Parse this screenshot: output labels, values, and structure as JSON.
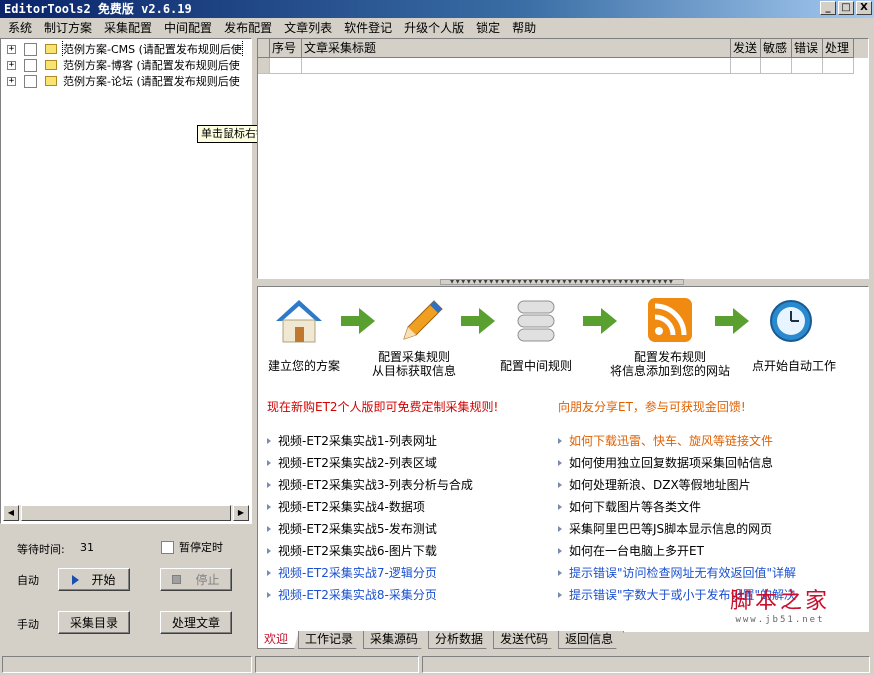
{
  "window": {
    "title": "EditorTools2 免费版 v2.6.19",
    "min": "_",
    "max": "□",
    "close": "X"
  },
  "menu": [
    "系统",
    "制订方案",
    "采集配置",
    "中间配置",
    "发布配置",
    "文章列表",
    "软件登记",
    "升级个人版",
    "锁定",
    "帮助"
  ],
  "tree": [
    {
      "label": "范例方案-CMS (请配置发布规则后使"
    },
    {
      "label": "范例方案-博客 (请配置发布规则后使"
    },
    {
      "label": "范例方案-论坛 (请配置发布规则后使"
    }
  ],
  "tooltip": "单击鼠标右键显示操作菜单",
  "controls": {
    "wait_label": "等待时间:",
    "wait_value": "31",
    "pause_label": "暂停定时",
    "auto_label": "自动",
    "start": "开始",
    "stop": "停止",
    "manual_label": "手动",
    "collect_dir": "采集目录",
    "process": "处理文章"
  },
  "grid": {
    "columns": [
      "序号",
      "文章采集标题",
      "发送",
      "敏感",
      "错误",
      "处理"
    ]
  },
  "steps": [
    {
      "line1": "建立您的方案",
      "line2": "",
      "icon": "home-icon"
    },
    {
      "line1": "配置采集规则",
      "line2": "从目标获取信息",
      "icon": "pencil-icon"
    },
    {
      "line1": "配置中间规则",
      "line2": "",
      "icon": "database-icon"
    },
    {
      "line1": "配置发布规则",
      "line2": "将信息添加到您的网站",
      "icon": "rss-icon"
    },
    {
      "line1": "点开始自动工作",
      "line2": "",
      "icon": "clock-icon"
    }
  ],
  "promo_left": "现在新购ET2个人版即可免费定制采集规则!",
  "promo_right": "向朋友分享ET，参与可获现金回馈!",
  "links_left": [
    "视频-ET2采集实战1-列表网址",
    "视频-ET2采集实战2-列表区域",
    "视频-ET2采集实战3-列表分析与合成",
    "视频-ET2采集实战4-数据项",
    "视频-ET2采集实战5-发布测试",
    "视频-ET2采集实战6-图片下载",
    "视频-ET2采集实战7-逻辑分页",
    "视频-ET2采集实战8-采集分页"
  ],
  "links_right": [
    "如何下载迅雷、快车、旋风等链接文件",
    "如何使用独立回复数据项采集回帖信息",
    "如何处理新浪、DZX等假地址图片",
    "如何下载图片等各类文件",
    "采集阿里巴巴等JS脚本显示信息的网页",
    "如何在一台电脑上多开ET",
    "提示错误\"访问检查网址无有效返回值\"详解",
    "提示错误\"字数大于或小于发布设置\"的解决"
  ],
  "colors": {
    "promo_left": "#d40000",
    "promo_right": "#e06000",
    "link_orange": "#e06000",
    "link_blue": "#1a4fd0",
    "link_default": "#000000"
  },
  "watermark": {
    "main": "脚本之家",
    "sub": "www.jb51.net"
  },
  "tabs": [
    "欢迎",
    "工作记录",
    "采集源码",
    "分析数据",
    "发送代码",
    "返回信息"
  ]
}
